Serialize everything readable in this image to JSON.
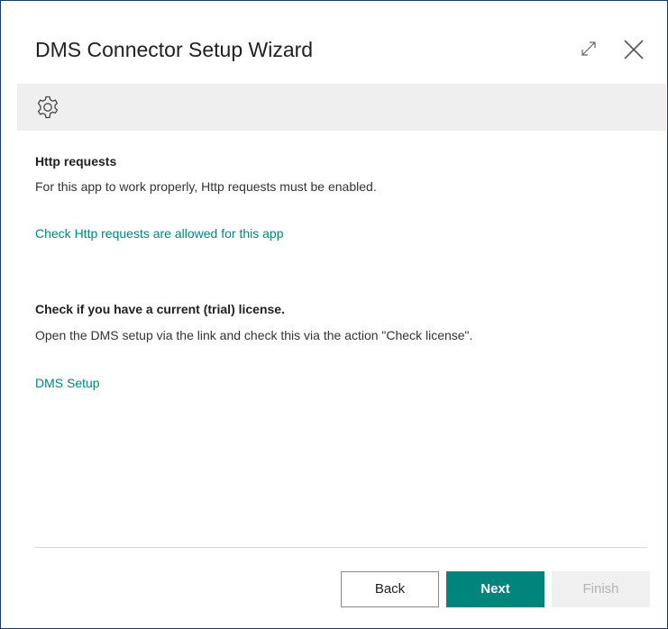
{
  "dialog": {
    "title": "DMS Connector Setup Wizard",
    "expand_icon": "expand-icon",
    "close_icon": "close-icon"
  },
  "toolbar": {
    "icon": "gear-icon"
  },
  "http_section": {
    "heading": "Http requests",
    "description": "For this app to work properly, Http requests must be enabled.",
    "link_text": "Check Http requests are allowed for this app"
  },
  "license_section": {
    "heading": "Check if you have a current (trial) license.",
    "description": "Open the DMS setup via the link and check this via the action \"Check license\".",
    "link_text": "DMS Setup"
  },
  "footer": {
    "back_label": "Back",
    "next_label": "Next",
    "finish_label": "Finish"
  },
  "colors": {
    "accent": "#00857d",
    "toolbar_bg": "#efefef",
    "disabled_bg": "#f0f0f0"
  }
}
